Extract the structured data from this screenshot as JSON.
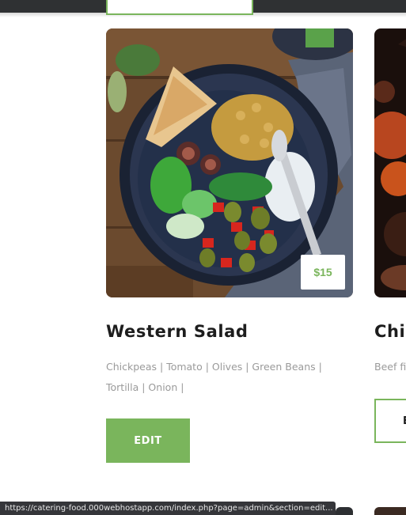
{
  "cards": [
    {
      "title": "Western Salad",
      "price": "$15",
      "description_lines": [
        "Chickpeas | Tomato | Olives | Green Beans |",
        "Tortilla | Onion |"
      ],
      "edit_label": "EDIT"
    },
    {
      "title": "Chil",
      "description_lines": [
        "Beef fi"
      ],
      "edit_label": "E"
    }
  ],
  "status_bar": {
    "url": "https://catering-food.000webhostapp.com/index.php?page=admin&section=edit..."
  },
  "colors": {
    "accent": "#7ab55c",
    "title": "#1d1d1d",
    "muted_text": "#9a9a9a",
    "status_bar": "#35363a"
  }
}
